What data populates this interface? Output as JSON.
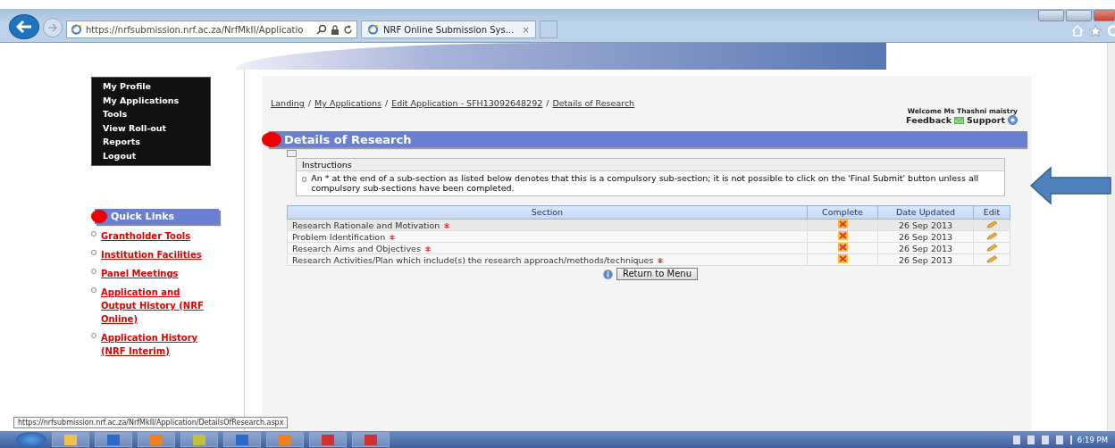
{
  "browser": {
    "address": "https://nrfsubmission.nrf.ac.za/NrfMkII/Applicatio",
    "tab_title": "NRF Online Submission Sys...",
    "tab_close": "×"
  },
  "nav_menu": [
    "My Profile",
    "My Applications",
    "Tools",
    "View Roll-out",
    "Reports",
    "Logout"
  ],
  "quick_links": {
    "title": "Quick Links",
    "items": [
      "Grantholder Tools",
      "Institution Facilities",
      "Panel Meetings",
      "Application and Output History (NRF Online)",
      "Application History (NRF Interim)"
    ]
  },
  "breadcrumb": [
    "Landing",
    "My Applications",
    "Edit Application - SFH13092648292",
    "Details of Research"
  ],
  "breadcrumb_separator": "/",
  "user": {
    "welcome": "Welcome Ms Thashni maistry",
    "feedback": "Feedback",
    "support": "Support"
  },
  "page_title": "Details of Research",
  "instructions": {
    "title": "Instructions",
    "text": "An * at the end of a sub-section as listed below denotes that this is a compulsory sub-section; it is not possible to click on the 'Final Submit' button unless all compulsory sub-sections have been completed."
  },
  "table": {
    "columns": [
      "Section",
      "Complete",
      "Date Updated",
      "Edit"
    ],
    "rows": [
      {
        "section": "Research Rationale and Motivation",
        "required": true,
        "complete": false,
        "date": "26 Sep 2013",
        "selected": true
      },
      {
        "section": "Problem Identification",
        "required": true,
        "complete": false,
        "date": "26 Sep 2013",
        "selected": false
      },
      {
        "section": "Research Aims and Objectives",
        "required": true,
        "complete": false,
        "date": "26 Sep 2013",
        "selected": false
      },
      {
        "section": "Research Activities/Plan which include(s) the research approach/methods/techniques",
        "required": true,
        "complete": false,
        "date": "26 Sep 2013",
        "selected": false
      }
    ]
  },
  "return_button": "Return to Menu",
  "status_url": "https://nrfsubmission.nrf.ac.za/NrfMkII/Application/DetailsOfResearch.aspx",
  "taskbar": {
    "time": "6:19 PM"
  }
}
